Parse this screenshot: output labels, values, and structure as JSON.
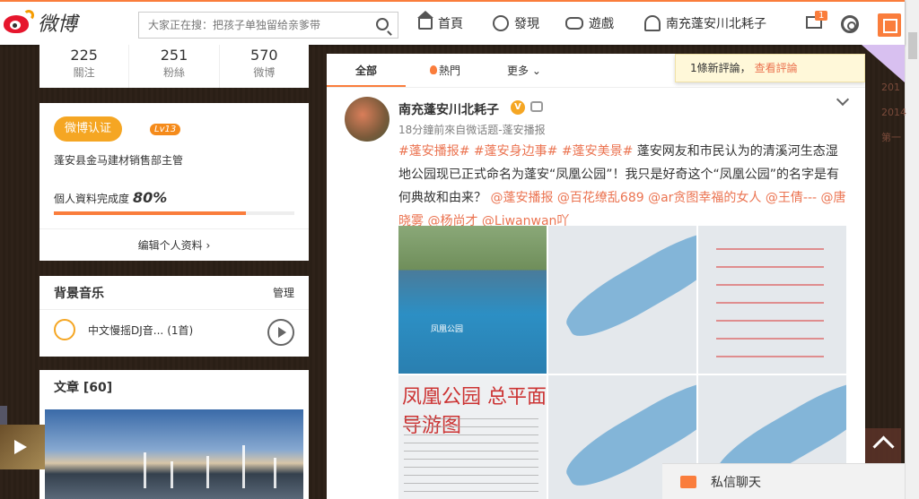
{
  "app": {
    "logo_text": "微博",
    "brand_color": "#fa7d3c"
  },
  "header": {
    "search_placeholder": "大家正在搜：把孩子单独留给亲爹带",
    "nav": [
      {
        "label": "首頁",
        "icon": "home-icon"
      },
      {
        "label": "發現",
        "icon": "compass-icon"
      },
      {
        "label": "遊戲",
        "icon": "gamepad-icon"
      },
      {
        "label": "南充蓬安川北耗子",
        "icon": "user-icon"
      }
    ],
    "mail_badge": "1"
  },
  "profile": {
    "stats": [
      {
        "num": "225",
        "label": "關注"
      },
      {
        "num": "251",
        "label": "粉絲"
      },
      {
        "num": "570",
        "label": "微博"
      }
    ],
    "verify_badge": "微博认证",
    "level": "Lv13",
    "job": "蓬安县金马建材销售部主管",
    "completion_label": "個人資料完成度",
    "completion_value": "80%",
    "completion_fraction": 0.8,
    "edit_link": "编辑个人资料"
  },
  "music": {
    "title": "背景音乐",
    "manage": "管理",
    "track": "中文慢摇DJ音...",
    "count": "(1首)"
  },
  "articles": {
    "title": "文章",
    "count": "[60]"
  },
  "feed": {
    "tabs": [
      {
        "label": "全部"
      },
      {
        "label": "熱門"
      },
      {
        "label": "更多"
      }
    ],
    "notice": {
      "text": "1條新評論，",
      "link": "查看評論"
    },
    "post": {
      "username": "南充蓬安川北耗子",
      "meta": "18分鐘前來自微话题-蓬安播报",
      "tags": [
        "#蓬安播报#",
        "#蓬安身边事#",
        "#蓬安美景#"
      ],
      "body": " 蓬安网友和市民认为的清溪河生态湿地公园现已正式命名为蓬安“凤凰公园”！我只是好奇这个“凤凰公园”的名字是有何典故和由来？",
      "mentions": [
        "@蓬安播报",
        "@百花缭乱689",
        "@ar贪图幸福的女人",
        "@王倩---",
        "@唐晓雾",
        "@杨尚才",
        "@Liwanwan吖"
      ],
      "photo_sign": "凤凰公园",
      "photo_title": "凤凰公园 总平面导游图"
    }
  },
  "right_strip": {
    "years": [
      "201",
      "2014",
      "第一"
    ]
  },
  "chat": {
    "label": "私信聊天"
  }
}
